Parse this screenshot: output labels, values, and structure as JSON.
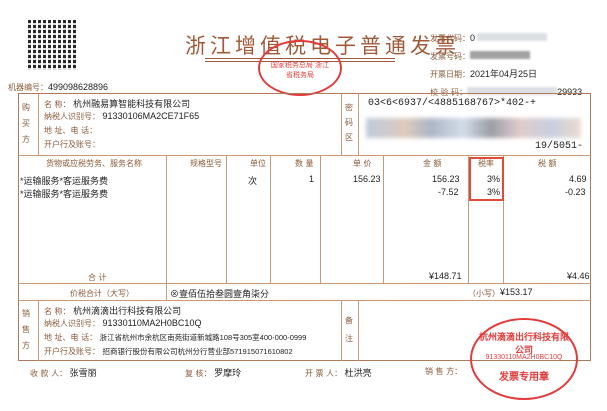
{
  "header": {
    "title": "浙江增值税电子普通发票",
    "seal_text": "国家税务总局 浙江省税务局",
    "machine_label": "机器编号：",
    "machine_value": "499098628896",
    "code_label": "发票代码：",
    "code_value": "0",
    "number_label": "发票号码：",
    "date_label": "开票日期：",
    "date_value": "2021年04月25日",
    "check_label": "校 验 码：",
    "check_value": "29933"
  },
  "buyer": {
    "side_label": "购 买 方",
    "name_label": "名 称：",
    "name_value": "杭州融易算智能科技有限公司",
    "tax_label": "纳税人识别号：",
    "tax_value": "91330106MA2CE71F65",
    "addr_label": "地 址、电 话：",
    "bank_label": "开户行及账号："
  },
  "cipher": {
    "side_label": "密 码 区",
    "line1": "03<6<6937/<4885168767>*402-+",
    "line2": "19/5051-"
  },
  "items": {
    "headers": [
      "货物或应税劳务、服务名称",
      "规格型号",
      "单位",
      "数 量",
      "单 价",
      "金 额",
      "税率",
      "税 额"
    ],
    "rows": [
      {
        "name": "*运输服务*客运服务费",
        "spec": "",
        "unit": "次",
        "qty": "1",
        "price": "156.23",
        "amount": "156.23",
        "rate": "3%",
        "tax": "4.69"
      },
      {
        "name": "*运输服务*客运服务费",
        "spec": "",
        "unit": "",
        "qty": "",
        "price": "",
        "amount": "-7.52",
        "rate": "3%",
        "tax": "-0.23"
      }
    ],
    "total_label": "合 计",
    "total_amount": "¥148.71",
    "total_tax": "¥4.46"
  },
  "sum": {
    "label": "价税合计（大写）",
    "upper": "⊗壹佰伍拾叁圆壹角柒分",
    "lower_label": "（小写）",
    "lower": "¥153.17"
  },
  "seller": {
    "side_label": "销 售 方",
    "name_label": "名 称：",
    "name_value": "杭州滴滴出行科技有限公司",
    "tax_label": "纳税人识别号：",
    "tax_value": "91330110MA2H0BC10Q",
    "addr_label": "地 址、电 话：",
    "addr_value": "浙江省杭州市余杭区南苑街道新城路108号305室400-000-0999",
    "bank_label": "开户行及账号：",
    "bank_value": "招商银行股份有限公司杭州分行营业部571915071610802",
    "remark_label": "备 注",
    "seal_top": "杭州滴滴出行科技有限公司",
    "seal_mid": "91330110MA2H0BC10Q",
    "seal_bottom": "发票专用章"
  },
  "footer": {
    "payee_label": "收 款 人：",
    "payee": "张雪丽",
    "review_label": "复 核：",
    "review": "罗摩玲",
    "drawer_label": "开 票 人：",
    "drawer": "杜洪亮",
    "seller_label": "销 售 方："
  }
}
